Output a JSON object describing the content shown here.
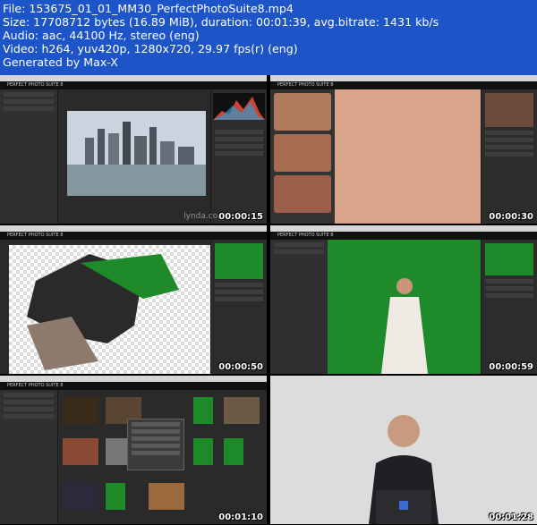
{
  "info": {
    "file": "File: 153675_01_01_MM30_PerfectPhotoSuite8.mp4",
    "size": "Size: 17708712 bytes (16.89 MiB), duration: 00:01:39, avg.bitrate: 1431 kb/s",
    "audio": "Audio: aac, 44100 Hz, stereo (eng)",
    "video": "Video: h264, yuv420p, 1280x720, 29.97 fps(r) (eng)",
    "generated": "Generated by Max-X"
  },
  "app": {
    "title": "Perfect Photo Suite 8",
    "logo": "PERFECT PHOTO SUITE 8"
  },
  "watermark": "lynda.com",
  "thumbnails": [
    {
      "timestamp": "00:00:15"
    },
    {
      "timestamp": "00:00:30"
    },
    {
      "timestamp": "00:00:50"
    },
    {
      "timestamp": "00:00:59"
    },
    {
      "timestamp": "00:01:10"
    },
    {
      "timestamp": "00:01:28"
    }
  ],
  "colors": {
    "header_bg": "#1d54c8",
    "app_bg": "#2a2a2a",
    "green_screen": "#1f8a2a"
  }
}
